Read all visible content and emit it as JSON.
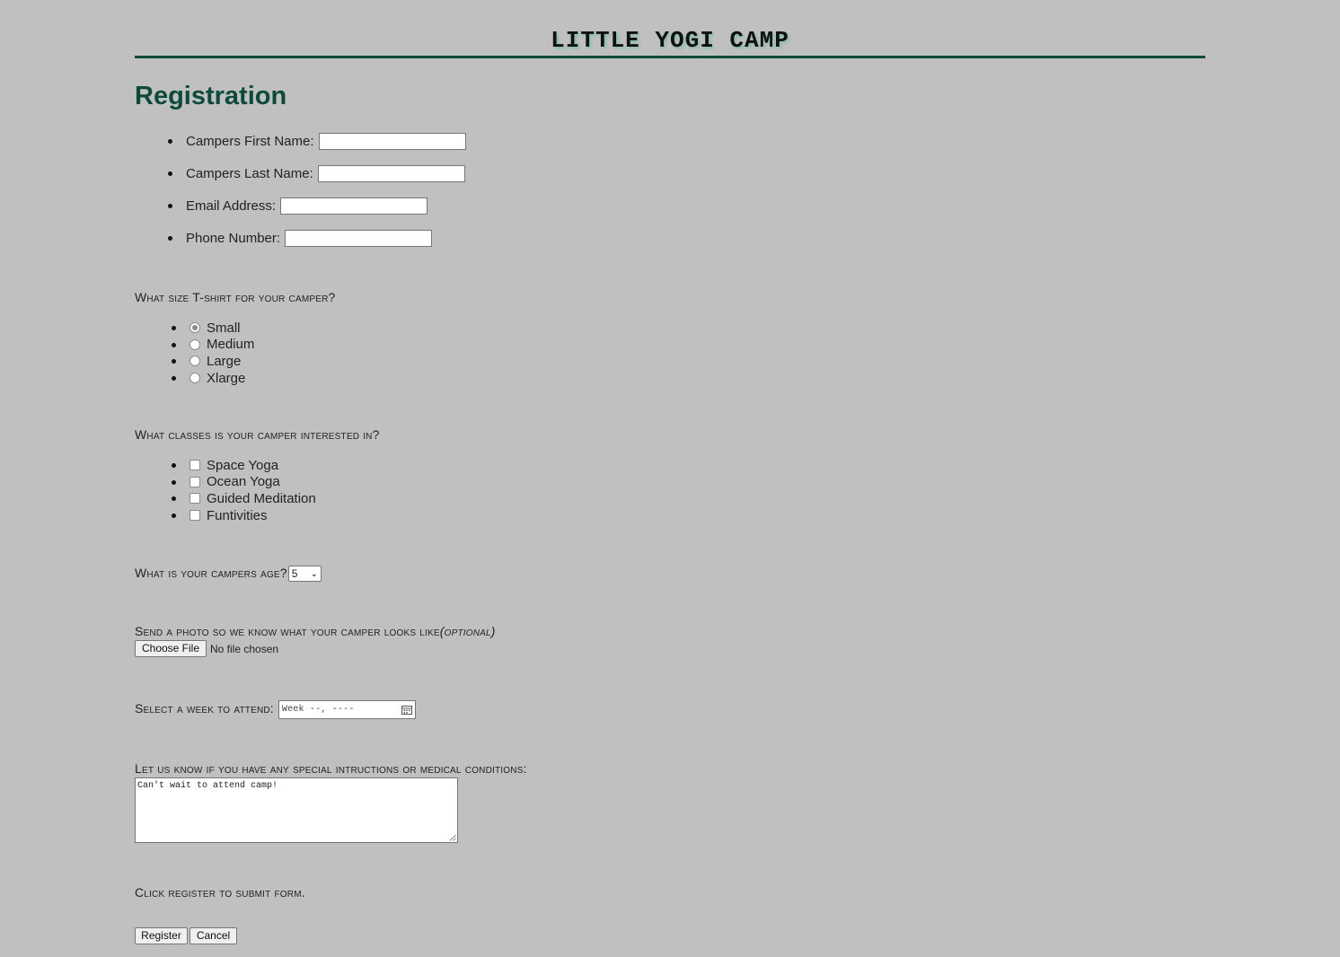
{
  "header": {
    "site_title": "LITTLE YOGI CAMP"
  },
  "form": {
    "heading": "Registration",
    "text_fields": [
      {
        "label": "Campers First Name:",
        "value": ""
      },
      {
        "label": "Campers Last Name:",
        "value": ""
      },
      {
        "label": "Email Address:",
        "value": ""
      },
      {
        "label": "Phone Number:",
        "value": ""
      }
    ],
    "tshirt": {
      "question": "What size T-shirt for your camper?",
      "options": [
        "Small",
        "Medium",
        "Large",
        "Xlarge"
      ],
      "selected": "Small"
    },
    "classes": {
      "question": "What classes is your camper interested in?",
      "options": [
        "Space Yoga",
        "Ocean Yoga",
        "Guided Meditation",
        "Funtivities"
      ],
      "checked": []
    },
    "age": {
      "question": "What is your campers age?",
      "selected": "5"
    },
    "photo": {
      "question": "Send a photo so we know what your camper looks like",
      "optional_note": "(optional)",
      "button_label": "Choose File",
      "status": "No file chosen"
    },
    "week": {
      "question": "Select a week to attend:",
      "placeholder": "Week --, ----"
    },
    "notes": {
      "question": "Let us know if you have any special intructions or medical conditions:",
      "value": "Can't wait to attend camp!"
    },
    "submit_note": "Click register to submit form.",
    "buttons": {
      "register": "Register",
      "cancel": "Cancel"
    }
  },
  "colors": {
    "background": "#c0c0c0",
    "heading_green": "#0e4a3a"
  }
}
